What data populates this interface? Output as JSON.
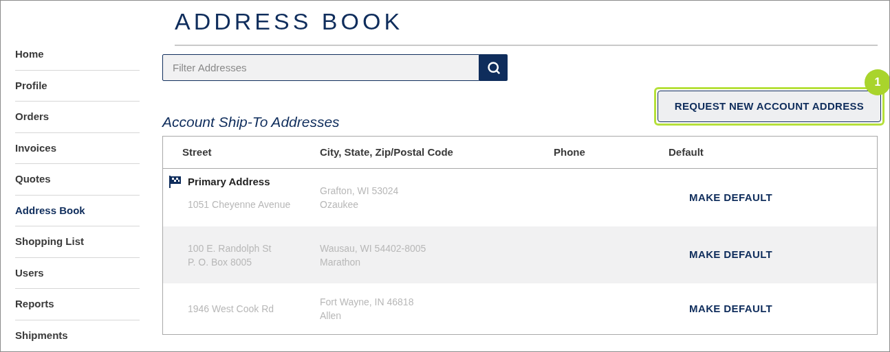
{
  "sidebar": {
    "items": [
      {
        "label": "Home",
        "selected": false
      },
      {
        "label": "Profile",
        "selected": false
      },
      {
        "label": "Orders",
        "selected": false
      },
      {
        "label": "Invoices",
        "selected": false
      },
      {
        "label": "Quotes",
        "selected": false
      },
      {
        "label": "Address Book",
        "selected": true
      },
      {
        "label": "Shopping List",
        "selected": false
      },
      {
        "label": "Users",
        "selected": false
      },
      {
        "label": "Reports",
        "selected": false
      },
      {
        "label": "Shipments",
        "selected": false
      }
    ]
  },
  "page_title": "ADDRESS BOOK",
  "search": {
    "placeholder": "Filter Addresses"
  },
  "section_title": "Account Ship-To Addresses",
  "request_button": {
    "label": "REQUEST NEW ACCOUNT ADDRESS",
    "callout": "1"
  },
  "table": {
    "columns": [
      "Street",
      "City, State, Zip/Postal Code",
      "Phone",
      "Default"
    ],
    "rows": [
      {
        "primary_label": "Primary Address",
        "street": [
          "1051 Cheyenne Avenue"
        ],
        "city": [
          "Grafton, WI 53024",
          "Ozaukee"
        ],
        "action": "MAKE DEFAULT"
      },
      {
        "street": [
          "100 E. Randolph St",
          "P. O. Box 8005"
        ],
        "city": [
          "Wausau, WI 54402-8005",
          "Marathon"
        ],
        "action": "MAKE DEFAULT"
      },
      {
        "street": [
          "1946 West Cook Rd"
        ],
        "city": [
          "Fort Wayne, IN 46818",
          "Allen"
        ],
        "action": "MAKE DEFAULT"
      }
    ]
  }
}
